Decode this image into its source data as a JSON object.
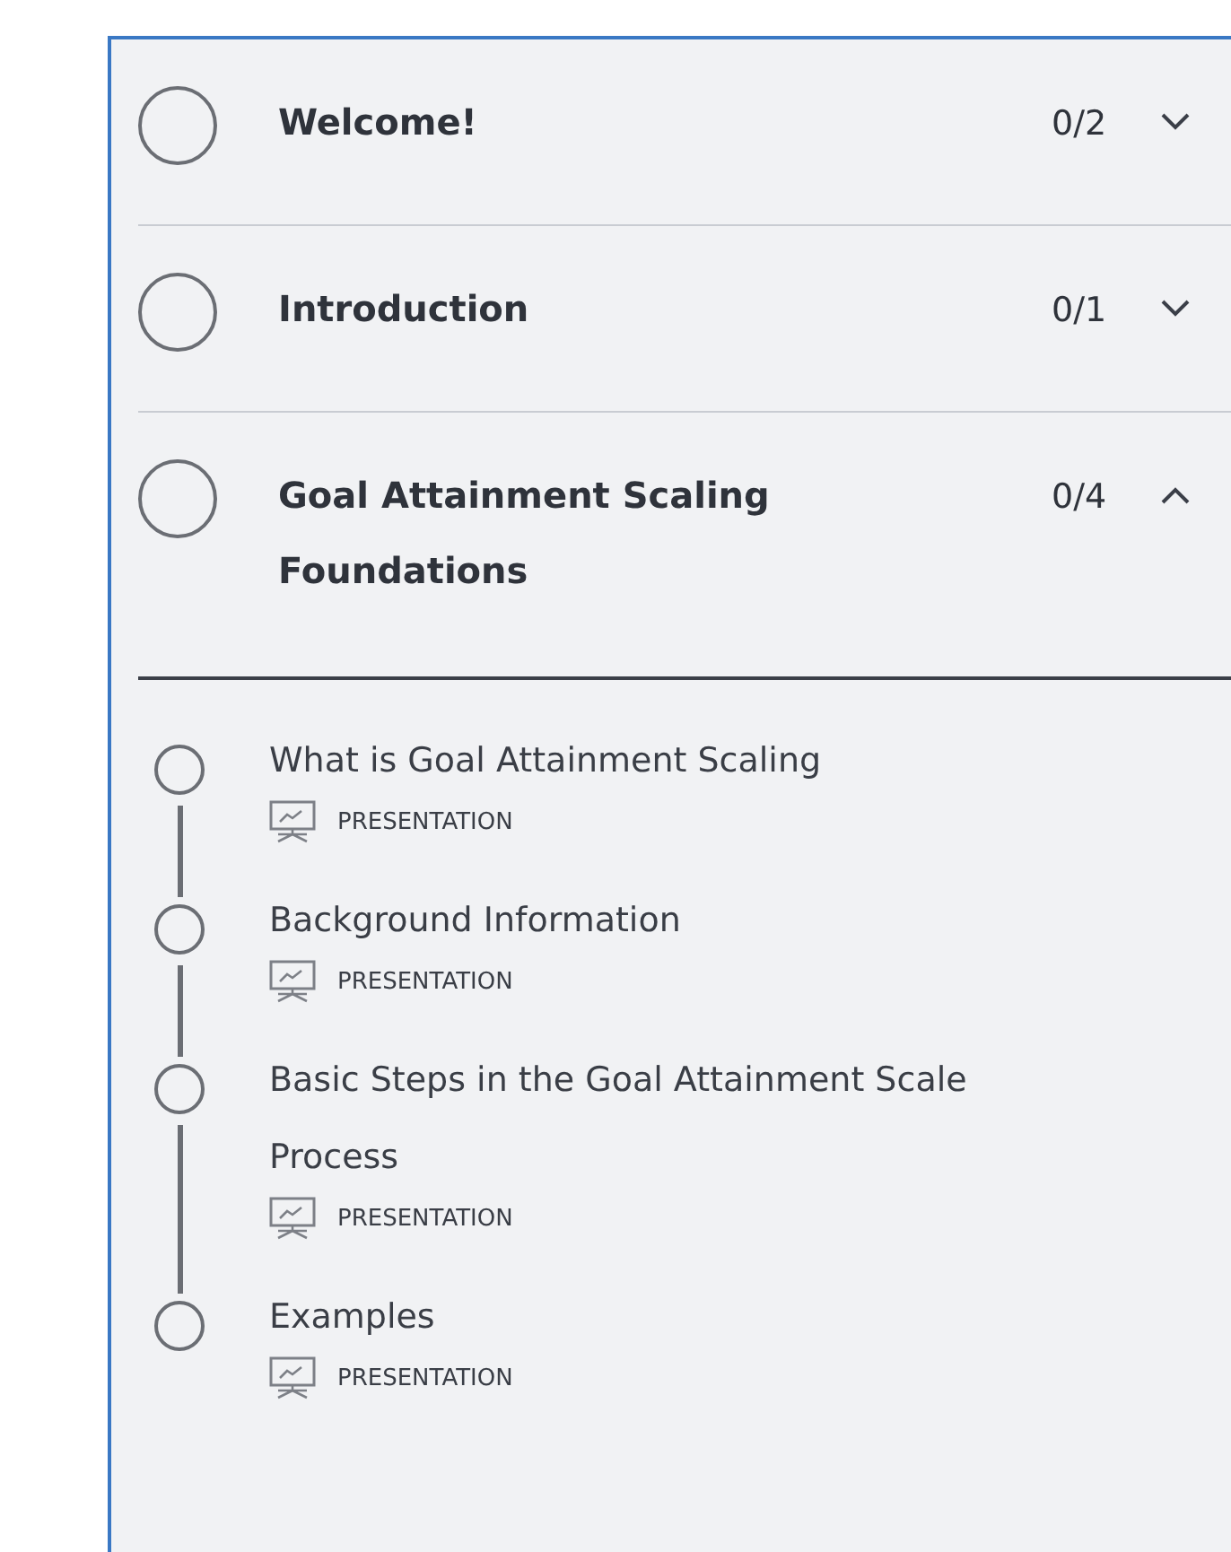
{
  "sections": [
    {
      "title": "Welcome!",
      "count": "0/2",
      "completed": false,
      "expanded": false
    },
    {
      "title": "Introduction",
      "count": "0/1",
      "completed": false,
      "expanded": false
    },
    {
      "title": "Goal Attainment Scaling Foundations",
      "count": "0/4",
      "completed": false,
      "expanded": true,
      "lessons": [
        {
          "title": "What is Goal Attainment Scaling",
          "kind": "presentation",
          "type_label": "PRESENTATION",
          "completed": false
        },
        {
          "title": "Background Information",
          "kind": "presentation",
          "type_label": "PRESENTATION",
          "completed": false
        },
        {
          "title": "Basic Steps in the Goal Attainment Scale Process",
          "kind": "presentation",
          "type_label": "PRESENTATION",
          "completed": false
        },
        {
          "title": "Examples",
          "kind": "presentation",
          "type_label": "PRESENTATION",
          "completed": false
        }
      ]
    }
  ]
}
